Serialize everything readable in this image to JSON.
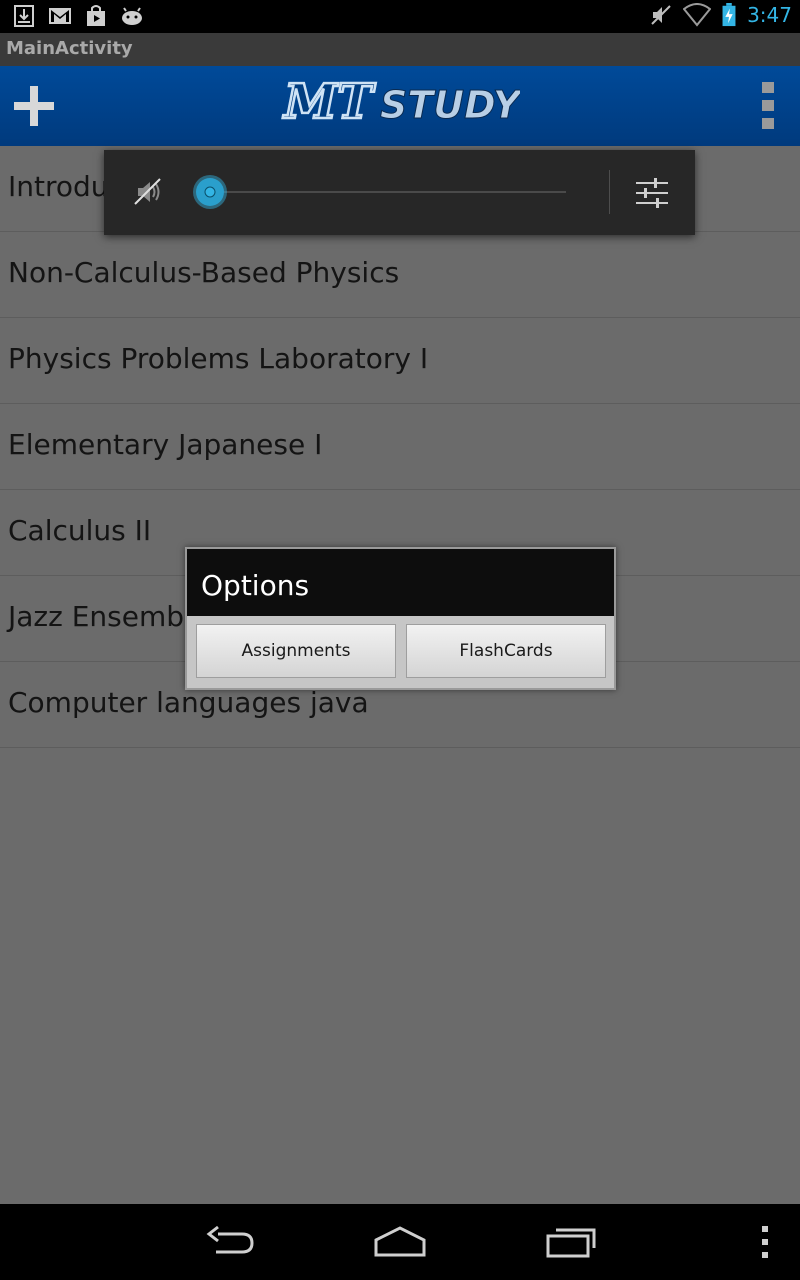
{
  "status_bar": {
    "time": "3:47",
    "icons": [
      "download-icon",
      "gmail-icon",
      "play-store-icon",
      "android-icon",
      "mute-icon",
      "wifi-icon",
      "battery-charging-icon"
    ]
  },
  "title_bar": {
    "title": "MainActivity"
  },
  "action_bar": {
    "logo_mark": "MT",
    "logo_text": "STUDY",
    "add_icon": "plus-icon",
    "overflow_icon": "overflow-menu-icon",
    "color": "#003d80"
  },
  "courses": [
    "Introductory Physics",
    "Non-Calculus-Based Physics",
    "Physics Problems Laboratory I",
    "Elementary Japanese I",
    "Calculus II",
    "Jazz Ensemble",
    "Computer languages java"
  ],
  "volume_panel": {
    "level": 0,
    "mute_icon": "speaker-muted-icon",
    "settings_icon": "sliders-icon",
    "accent": "#33b5e5"
  },
  "dialog": {
    "title": "Options",
    "buttons": [
      "Assignments",
      "FlashCards"
    ]
  },
  "nav_bar": {
    "icons": [
      "back-icon",
      "home-icon",
      "recent-apps-icon",
      "menu-icon"
    ]
  }
}
